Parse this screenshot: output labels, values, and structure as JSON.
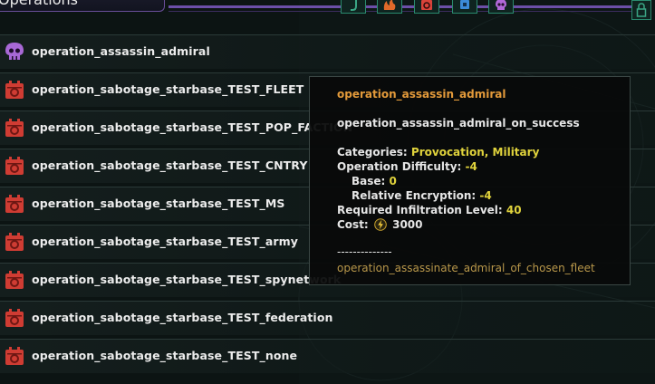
{
  "header": {
    "title": "Operations",
    "filters": [
      {
        "icon": "scroll-icon",
        "color": "#3aa584"
      },
      {
        "icon": "flame-icon",
        "color": "#e06a2a"
      },
      {
        "icon": "sabotage-icon",
        "color": "#d8433a"
      },
      {
        "icon": "chip-icon",
        "color": "#3b8ad8"
      },
      {
        "icon": "skull-icon",
        "color": "#b068d8"
      }
    ],
    "side_button_icon": "lock-icon"
  },
  "operations": [
    {
      "label": "operation_assassin_admiral",
      "icon": "skull-icon"
    },
    {
      "label": "operation_sabotage_starbase_TEST_FLEET",
      "icon": "sabotage-icon"
    },
    {
      "label": "operation_sabotage_starbase_TEST_POP_FACTION",
      "icon": "sabotage-icon"
    },
    {
      "label": "operation_sabotage_starbase_TEST_CNTRY",
      "icon": "sabotage-icon"
    },
    {
      "label": "operation_sabotage_starbase_TEST_MS",
      "icon": "sabotage-icon"
    },
    {
      "label": "operation_sabotage_starbase_TEST_army",
      "icon": "sabotage-icon"
    },
    {
      "label": "operation_sabotage_starbase_TEST_spynetwork",
      "icon": "sabotage-icon"
    },
    {
      "label": "operation_sabotage_starbase_TEST_federation",
      "icon": "sabotage-icon"
    },
    {
      "label": "operation_sabotage_starbase_TEST_none",
      "icon": "sabotage-icon"
    }
  ],
  "tooltip": {
    "title": "operation_assassin_admiral",
    "description": "operation_assassin_admiral_on_success",
    "categories_label": "Categories:",
    "categories_value": "Provocation, Military",
    "difficulty_label": "Operation Difficulty:",
    "difficulty_value": "-4",
    "base_label": "Base:",
    "base_value": "0",
    "encryption_label": "Relative Encryption:",
    "encryption_value": "-4",
    "infiltration_label": "Required Infiltration Level:",
    "infiltration_value": "40",
    "cost_label": "Cost:",
    "cost_icon": "energy-bolt-icon",
    "cost_value": "3000",
    "separator": "--------------",
    "footer": "operation_assassinate_admiral_of_chosen_fleet"
  },
  "colors": {
    "accent_purple": "#6c4fa8",
    "accent_teal": "#2a8a6e",
    "title_orange": "#e39a3a",
    "value_yellow": "#e0d33c",
    "sabotage_red": "#d8433a",
    "skull_purple": "#b068d8"
  }
}
